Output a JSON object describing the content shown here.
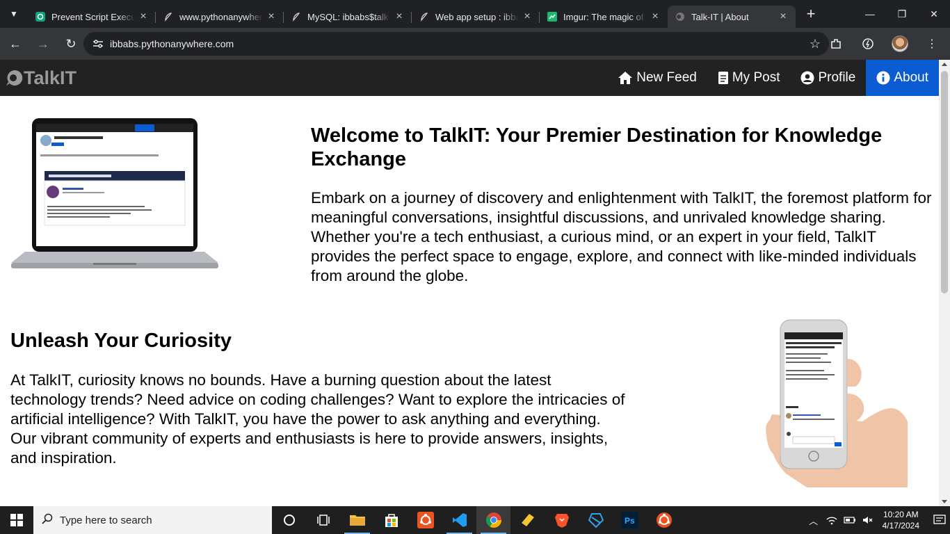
{
  "browser": {
    "tabs": [
      {
        "title": "Prevent Script Executi",
        "icon": "chatgpt-icon",
        "active": false
      },
      {
        "title": "www.pythonanywhere",
        "icon": "pythonanywhere-icon",
        "active": false
      },
      {
        "title": "MySQL: ibbabs$talk-it",
        "icon": "pythonanywhere-icon",
        "active": false
      },
      {
        "title": "Web app setup : ibba",
        "icon": "pythonanywhere-icon",
        "active": false
      },
      {
        "title": "Imgur: The magic of t",
        "icon": "imgur-icon",
        "active": false
      },
      {
        "title": "Talk-IT | About",
        "icon": "talkit-icon",
        "active": true
      }
    ],
    "url": "ibbabs.pythonanywhere.com"
  },
  "site": {
    "brand": "TalkIT",
    "nav": {
      "new_feed": "New Feed",
      "my_post": "My Post",
      "profile": "Profile",
      "about": "About"
    },
    "welcome": {
      "title": "Welcome to TalkIT: Your Premier Destination for Knowledge Exchange",
      "body": "Embark on a journey of discovery and enlightenment with TalkIT, the foremost platform for meaningful conversations, insightful discussions, and unrivaled knowledge sharing. Whether you're a tech enthusiast, a curious mind, or an expert in your field, TalkIT provides the perfect space to engage, explore, and connect with like-minded individuals from around the globe."
    },
    "curiosity": {
      "title": "Unleash Your Curiosity",
      "body": "At TalkIT, curiosity knows no bounds. Have a burning question about the latest technology trends? Need advice on coding challenges? Want to explore the intricacies of artificial intelligence? With TalkIT, you have the power to ask anything and everything. Our vibrant community of experts and enthusiasts is here to provide answers, insights, and inspiration."
    },
    "colors": {
      "nav_bg": "#222222",
      "active_tab": "#0b5bd3"
    }
  },
  "taskbar": {
    "search_placeholder": "Type here to search",
    "time": "10:20 AM",
    "date": "4/17/2024",
    "apps": [
      "cortana-icon",
      "task-view-icon",
      "file-explorer-icon",
      "store-icon",
      "ubuntu-icon",
      "vscode-icon",
      "chrome-icon",
      "notes-icon",
      "brave-icon",
      "dart-icon",
      "photoshop-icon",
      "ubuntu-icon"
    ]
  }
}
